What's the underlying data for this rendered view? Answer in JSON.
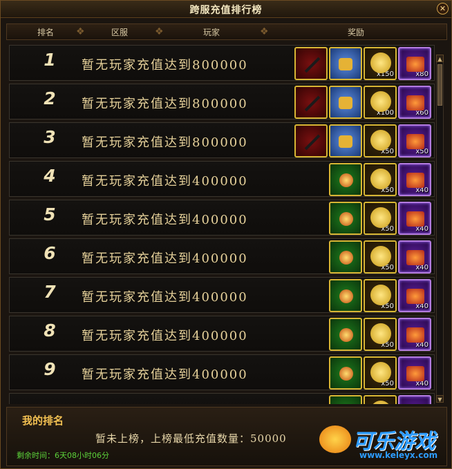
{
  "window": {
    "title": "跨服充值排行榜",
    "close_label": "✕"
  },
  "header": {
    "col_rank": "排名",
    "col_server": "区服",
    "col_player": "玩家",
    "col_reward": "奖励"
  },
  "rows": [
    {
      "rank": "1",
      "player": "暂无玩家充值达到800000"
    },
    {
      "rank": "2",
      "player": "暂无玩家充值达到800000"
    },
    {
      "rank": "3",
      "player": "暂无玩家充值达到800000"
    },
    {
      "rank": "4",
      "player": "暂无玩家充值达到400000"
    },
    {
      "rank": "5",
      "player": "暂无玩家充值达到400000"
    },
    {
      "rank": "6",
      "player": "暂无玩家充值达到400000"
    },
    {
      "rank": "7",
      "player": "暂无玩家充值达到400000"
    },
    {
      "rank": "8",
      "player": "暂无玩家充值达到400000"
    },
    {
      "rank": "9",
      "player": "暂无玩家充值达到400000"
    }
  ],
  "rewards": {
    "r1": {
      "gold_qty": "x150",
      "chest_qty": "x80"
    },
    "r2": {
      "gold_qty": "x100",
      "chest_qty": "x60"
    },
    "r3": {
      "gold_qty": "x50",
      "chest_qty": "x50"
    },
    "r4to9": {
      "gold_qty": "x50",
      "chest_qty": "x40"
    }
  },
  "icons": {
    "r1_3": [
      "weapon-icon",
      "crown-icon",
      "gold-coin-icon",
      "treasure-chest-icon"
    ],
    "r4_9": [
      "green-gem-icon",
      "gold-coin-icon",
      "treasure-chest-icon"
    ]
  },
  "my_rank": {
    "title": "我的排名",
    "status": "暂未上榜，上榜最低充值数量：50000",
    "time_left": "剩余时间：6天08小时06分"
  },
  "watermark": {
    "brand": "可乐游戏",
    "url": "www.keleyx.com"
  },
  "colors": {
    "gold_border": "#d8b634",
    "purple_border": "#b37bdf",
    "timer_green": "#5cd23a",
    "title_gold": "#f2c052"
  }
}
